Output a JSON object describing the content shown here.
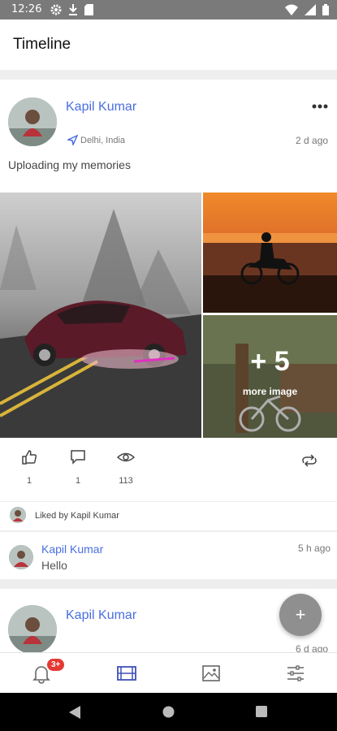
{
  "status_bar": {
    "time": "12:26"
  },
  "app_bar": {
    "title": "Timeline"
  },
  "posts": [
    {
      "author": "Kapil Kumar",
      "location": "Delhi, India",
      "time_ago": "2 d ago",
      "caption": "Uploading my memories",
      "more_images": {
        "count": "+ 5",
        "label": "more image"
      },
      "stats": {
        "likes": "1",
        "comments": "1",
        "views": "113"
      },
      "liked_by": "Liked by Kapil Kumar",
      "comment": {
        "author": "Kapil Kumar",
        "text": "Hello",
        "time_ago": "5 h ago"
      }
    },
    {
      "author": "Kapil Kumar",
      "time_ago": "6 d ago"
    }
  ],
  "fab": {
    "label": "+"
  },
  "bottom_nav": {
    "notification_badge": "3+",
    "items": [
      "bell-icon",
      "film-icon",
      "image-icon",
      "settings-sliders-icon"
    ],
    "active_color": "#3f51b5"
  },
  "colors": {
    "link": "#4a6ee0",
    "badge": "#e53935"
  }
}
